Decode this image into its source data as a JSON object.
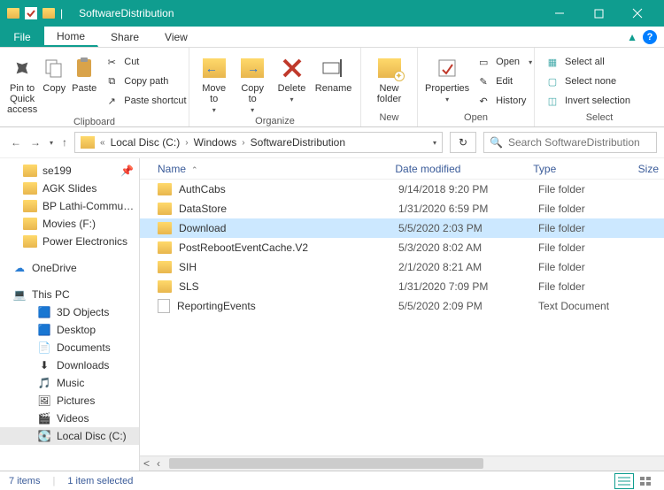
{
  "title": "SoftwareDistribution",
  "menu": {
    "file": "File",
    "home": "Home",
    "share": "Share",
    "view": "View"
  },
  "ribbon": {
    "pin": "Pin to Quick\naccess",
    "copy": "Copy",
    "paste": "Paste",
    "cut": "Cut",
    "copy_path": "Copy path",
    "paste_shortcut": "Paste shortcut",
    "move_to": "Move\nto",
    "copy_to": "Copy\nto",
    "delete": "Delete",
    "rename": "Rename",
    "new_folder": "New\nfolder",
    "properties": "Properties",
    "open": "Open",
    "edit": "Edit",
    "history": "History",
    "select_all": "Select all",
    "select_none": "Select none",
    "invert": "Invert selection",
    "g_clipboard": "Clipboard",
    "g_organize": "Organize",
    "g_new": "New",
    "g_open": "Open",
    "g_select": "Select"
  },
  "breadcrumb": {
    "drive": "Local Disc (C:)",
    "folder1": "Windows",
    "folder2": "SoftwareDistribution"
  },
  "search": {
    "placeholder": "Search SoftwareDistribution"
  },
  "tree": {
    "items": [
      {
        "label": "se199",
        "icon": "folder",
        "lvl": 1
      },
      {
        "label": "AGK Slides",
        "icon": "folder",
        "lvl": 1
      },
      {
        "label": "BP Lathi-Commu…",
        "icon": "folder",
        "lvl": 1
      },
      {
        "label": "Movies (F:)",
        "icon": "drive",
        "lvl": 1
      },
      {
        "label": "Power Electronics",
        "icon": "folder",
        "lvl": 1
      }
    ],
    "onedrive": "OneDrive",
    "thispc": "This PC",
    "pc_items": [
      {
        "label": "3D Objects",
        "icon": "3d"
      },
      {
        "label": "Desktop",
        "icon": "desktop"
      },
      {
        "label": "Documents",
        "icon": "doc"
      },
      {
        "label": "Downloads",
        "icon": "down"
      },
      {
        "label": "Music",
        "icon": "music"
      },
      {
        "label": "Pictures",
        "icon": "pic"
      },
      {
        "label": "Videos",
        "icon": "video"
      },
      {
        "label": "Local Disc (C:)",
        "icon": "disk",
        "selected": true
      }
    ]
  },
  "columns": {
    "name": "Name",
    "date": "Date modified",
    "type": "Type",
    "size": "Size"
  },
  "files": [
    {
      "name": "AuthCabs",
      "date": "9/14/2018 9:20 PM",
      "type": "File folder",
      "kind": "folder"
    },
    {
      "name": "DataStore",
      "date": "1/31/2020 6:59 PM",
      "type": "File folder",
      "kind": "folder"
    },
    {
      "name": "Download",
      "date": "5/5/2020 2:03 PM",
      "type": "File folder",
      "kind": "folder",
      "selected": true
    },
    {
      "name": "PostRebootEventCache.V2",
      "date": "5/3/2020 8:02 AM",
      "type": "File folder",
      "kind": "folder"
    },
    {
      "name": "SIH",
      "date": "2/1/2020 8:21 AM",
      "type": "File folder",
      "kind": "folder"
    },
    {
      "name": "SLS",
      "date": "1/31/2020 7:09 PM",
      "type": "File folder",
      "kind": "folder"
    },
    {
      "name": "ReportingEvents",
      "date": "5/5/2020 2:09 PM",
      "type": "Text Document",
      "kind": "doc"
    }
  ],
  "status": {
    "count": "7 items",
    "selected": "1 item selected"
  }
}
